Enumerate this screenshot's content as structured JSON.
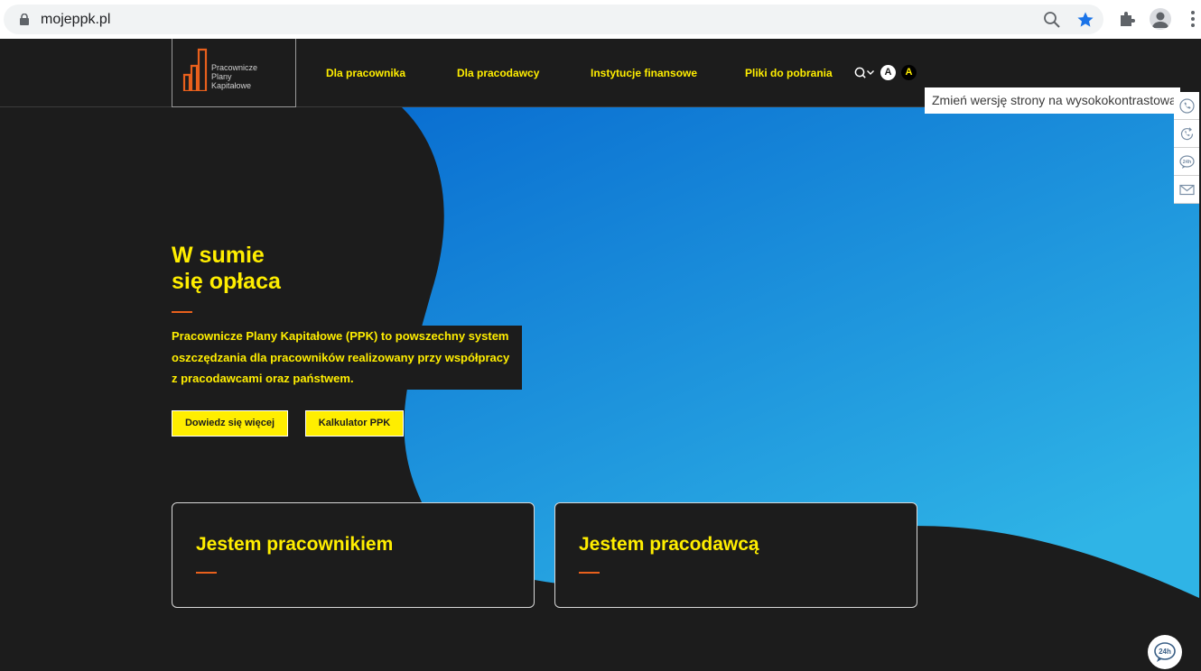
{
  "browser": {
    "url": "mojeppk.pl",
    "icons": [
      "lock-icon",
      "zoom-icon",
      "bookmark-star-icon",
      "extensions-icon",
      "profile-icon",
      "menu-icon"
    ]
  },
  "logo": {
    "line1": "Pracownicze",
    "line2": "Plany",
    "line3": "Kapitałowe"
  },
  "nav": {
    "items": [
      {
        "label": "Dla pracownika"
      },
      {
        "label": "Dla pracodawcy"
      },
      {
        "label": "Instytucje finansowe"
      },
      {
        "label": "Pliki do pobrania"
      }
    ],
    "contrast_normal": "A",
    "contrast_high": "A"
  },
  "tooltip": "Zmień wersję strony na wysokokontrastową",
  "hero": {
    "title_line1": "W sumie",
    "title_line2": "się opłaca",
    "description": "Pracownicze Plany Kapitałowe (PPK) to powszechny system oszczędzania dla pracowników realizowany przy współpracy z pracodawcami oraz państwem.",
    "button_more": "Dowiedz się więcej",
    "button_calc": "Kalkulator PPK"
  },
  "cards": [
    {
      "title": "Jestem pracownikiem"
    },
    {
      "title": "Jestem pracodawcą"
    }
  ],
  "side_panel": {
    "icons": [
      "phone-icon",
      "callback-icon",
      "chat-24h-icon",
      "mail-icon"
    ]
  },
  "chat_widget": {
    "label": "24h"
  },
  "colors": {
    "accent": "#ffee00",
    "underline": "#e8601c",
    "background": "#1c1c1c",
    "blue_start": "#0a6fd1",
    "blue_end": "#2fb4e6"
  }
}
